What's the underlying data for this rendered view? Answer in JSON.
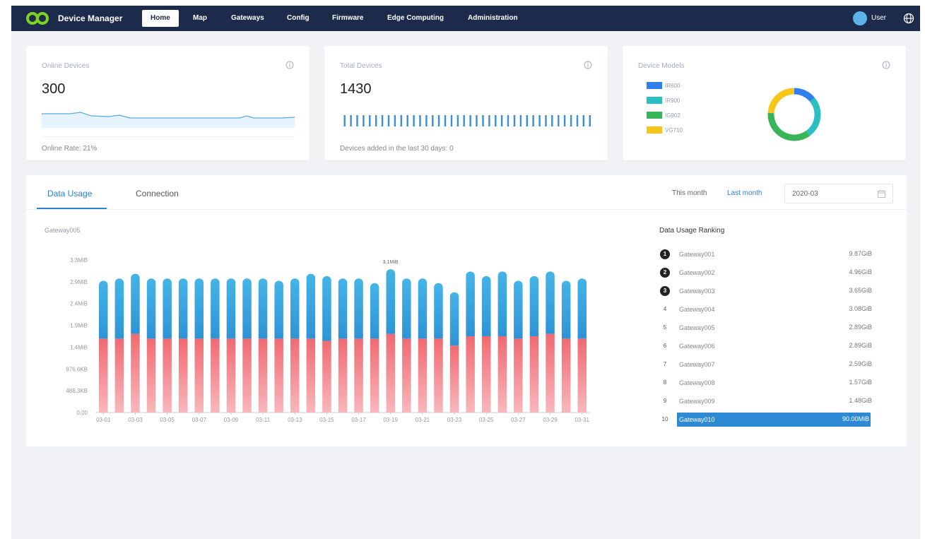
{
  "nav": {
    "brand": "Device Manager",
    "items": [
      "Home",
      "Map",
      "Gateways",
      "Config",
      "Firmware",
      "Edge Computing",
      "Administration"
    ],
    "active_index": 0,
    "user": "User"
  },
  "cards": {
    "online": {
      "title": "Online Devices",
      "value": "300",
      "footer": "Online Rate: 21%"
    },
    "total": {
      "title": "Total Devices",
      "value": "1430",
      "footer": "Devices added in the last 30 days: 0"
    },
    "models": {
      "title": "Device Models",
      "legend": [
        {
          "name": "IR600",
          "color": "#2f80ed"
        },
        {
          "name": "IR900",
          "color": "#2bbfc4"
        },
        {
          "name": "IG902",
          "color": "#39b559"
        },
        {
          "name": "VG710",
          "color": "#f5c518"
        }
      ],
      "donut_share": [
        0.14,
        0.26,
        0.36,
        0.24
      ]
    }
  },
  "panel": {
    "tabs": [
      "Data Usage",
      "Connection"
    ],
    "active_tab": 0,
    "range": {
      "this_month": "This month",
      "last_month": "Last month"
    },
    "date_value": "2020-03"
  },
  "chart_data": {
    "type": "bar",
    "title": "Gateway005",
    "y_tick_labels": [
      "0.00",
      "488.3KB",
      "976.6KB",
      "1.4MiB",
      "1.9MiB",
      "2.4MiB",
      "2.9MiB",
      "3.3MiB"
    ],
    "ylim": [
      0,
      3.3
    ],
    "categories": [
      "03-01",
      "03-02",
      "03-03",
      "03-04",
      "03-05",
      "03-06",
      "03-07",
      "03-08",
      "03-09",
      "03-10",
      "03-11",
      "03-12",
      "03-13",
      "03-14",
      "03-15",
      "03-16",
      "03-17",
      "03-18",
      "03-19",
      "03-20",
      "03-21",
      "03-22",
      "03-23",
      "03-24",
      "03-25",
      "03-26",
      "03-27",
      "03-28",
      "03-29",
      "03-30",
      "03-31"
    ],
    "x_tick_labels": [
      "03-01",
      "03-03",
      "03-05",
      "03-07",
      "03-09",
      "03-11",
      "03-13",
      "03-15",
      "03-17",
      "03-19",
      "03-21",
      "03-23",
      "03-25",
      "03-27",
      "03-29",
      "03-31"
    ],
    "series": [
      {
        "values": [
          1.6,
          1.6,
          1.7,
          1.6,
          1.6,
          1.6,
          1.6,
          1.6,
          1.6,
          1.6,
          1.6,
          1.6,
          1.6,
          1.6,
          1.55,
          1.6,
          1.6,
          1.6,
          1.7,
          1.6,
          1.6,
          1.6,
          1.45,
          1.65,
          1.65,
          1.65,
          1.6,
          1.65,
          1.7,
          1.6,
          1.6
        ]
      },
      {
        "values": [
          1.25,
          1.3,
          1.3,
          1.3,
          1.3,
          1.3,
          1.3,
          1.3,
          1.3,
          1.3,
          1.3,
          1.25,
          1.3,
          1.4,
          1.4,
          1.3,
          1.3,
          1.2,
          1.4,
          1.3,
          1.3,
          1.2,
          1.15,
          1.4,
          1.3,
          1.4,
          1.25,
          1.3,
          1.35,
          1.25,
          1.3
        ]
      }
    ],
    "annotation": {
      "index": 18,
      "label": "3.1MiB"
    }
  },
  "ranking": {
    "title": "Data Usage Ranking",
    "items": [
      {
        "rank": "1",
        "name": "Gateway001",
        "value": "9.87GiB"
      },
      {
        "rank": "2",
        "name": "Gateway002",
        "value": "4.96GiB"
      },
      {
        "rank": "3",
        "name": "Gateway003",
        "value": "3.65GiB"
      },
      {
        "rank": "4",
        "name": "Gateway004",
        "value": "3.08GiB"
      },
      {
        "rank": "5",
        "name": "Gateway005",
        "value": "2.89GiB"
      },
      {
        "rank": "6",
        "name": "Gateway006",
        "value": "2.89GiB"
      },
      {
        "rank": "7",
        "name": "Gateway007",
        "value": "2.59GiB"
      },
      {
        "rank": "8",
        "name": "Gateway008",
        "value": "1.57GiB"
      },
      {
        "rank": "9",
        "name": "Gateway009",
        "value": "1.48GiB"
      },
      {
        "rank": "10",
        "name": "Gateway010",
        "value": "90.00MiB"
      }
    ],
    "highlight_index": 9
  },
  "colors": {
    "nav_bg": "#1c2b4b",
    "accent": "#2f80d1",
    "bar_top": "#3fa9e0",
    "bar_bottom": "#f2727a"
  }
}
